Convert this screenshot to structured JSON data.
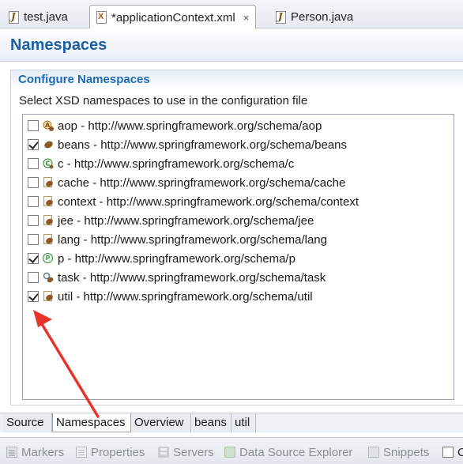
{
  "editor_tabs": [
    {
      "label": "test.java",
      "icon": "java-file-icon",
      "active": false
    },
    {
      "label": "*applicationContext.xml",
      "icon": "xml-file-icon",
      "active": true,
      "close": "×"
    },
    {
      "label": "Person.java",
      "icon": "java-file-icon",
      "active": false
    }
  ],
  "header": {
    "title": "Namespaces"
  },
  "section": {
    "title": "Configure Namespaces",
    "description": "Select XSD namespaces to use in the configuration file"
  },
  "namespaces": [
    {
      "label": "aop - http://www.springframework.org/schema/aop",
      "checked": false,
      "icon": "aop-namespace-icon"
    },
    {
      "label": "beans - http://www.springframework.org/schema/beans",
      "checked": true,
      "icon": "bean-icon"
    },
    {
      "label": "c - http://www.springframework.org/schema/c",
      "checked": false,
      "icon": "c-namespace-icon"
    },
    {
      "label": "cache - http://www.springframework.org/schema/cache",
      "checked": false,
      "icon": "bean-page-icon"
    },
    {
      "label": "context - http://www.springframework.org/schema/context",
      "checked": false,
      "icon": "bean-page-icon"
    },
    {
      "label": "jee - http://www.springframework.org/schema/jee",
      "checked": false,
      "icon": "bean-page-icon"
    },
    {
      "label": "lang - http://www.springframework.org/schema/lang",
      "checked": false,
      "icon": "bean-page-icon"
    },
    {
      "label": "p - http://www.springframework.org/schema/p",
      "checked": true,
      "icon": "p-namespace-icon"
    },
    {
      "label": "task - http://www.springframework.org/schema/task",
      "checked": false,
      "icon": "task-namespace-icon"
    },
    {
      "label": "util - http://www.springframework.org/schema/util",
      "checked": true,
      "icon": "bean-page-icon"
    }
  ],
  "page_tabs": [
    {
      "label": "Source",
      "active": false
    },
    {
      "label": "Namespaces",
      "active": true
    },
    {
      "label": "Overview",
      "active": false
    },
    {
      "label": "beans",
      "active": false
    },
    {
      "label": "util",
      "active": false
    }
  ],
  "views": [
    {
      "label": "Markers",
      "icon": "markers-icon"
    },
    {
      "label": "Properties",
      "icon": "properties-icon"
    },
    {
      "label": "Servers",
      "icon": "servers-icon"
    },
    {
      "label": "Data Source Explorer",
      "icon": "data-source-explorer-icon"
    },
    {
      "label": "Snippets",
      "icon": "snippets-icon"
    },
    {
      "label": "C",
      "icon": "console-icon"
    }
  ],
  "colors": {
    "title_blue": "#1c5fa5",
    "section_blue": "#1c6bb5",
    "annotation_red": "#e8332a"
  }
}
